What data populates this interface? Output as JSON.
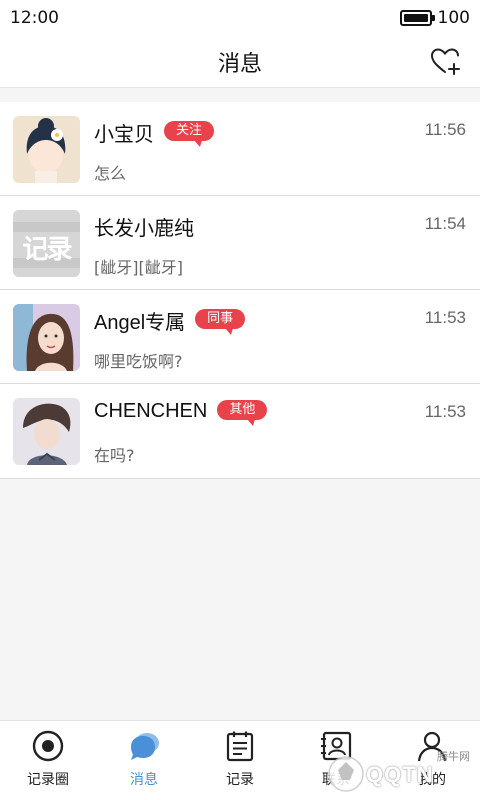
{
  "status_bar": {
    "time": "12:00",
    "battery": "100"
  },
  "header": {
    "title": "消息",
    "action_icon": "heart-plus-icon"
  },
  "messages": [
    {
      "name": "小宝贝",
      "tag": "关注",
      "time": "11:56",
      "preview": "怎么",
      "avatar": "girl-flower-avatar"
    },
    {
      "name": "长发小鹿纯",
      "tag": "",
      "time": "11:54",
      "preview": "[龇牙][龇牙]",
      "avatar": "app-logo-avatar",
      "avatar_text": "记录"
    },
    {
      "name": "Angel专属",
      "tag": "同事",
      "time": "11:53",
      "preview": "哪里吃饭啊?",
      "avatar": "woman-portrait-avatar"
    },
    {
      "name": "CHENCHEN",
      "tag": "其他",
      "time": "11:53",
      "preview": "在吗?",
      "avatar": "man-portrait-avatar"
    }
  ],
  "bottom_nav": [
    {
      "label": "记录圈",
      "icon": "eye-circle-icon",
      "active": false
    },
    {
      "label": "消息",
      "icon": "chat-bubble-icon",
      "active": true
    },
    {
      "label": "记录",
      "icon": "notepad-icon",
      "active": false
    },
    {
      "label": "联系",
      "icon": "contact-card-icon",
      "active": false
    },
    {
      "label": "我的",
      "icon": "user-icon",
      "active": false
    }
  ],
  "colors": {
    "tag": "#e8424b",
    "active_nav": "#4a90d9",
    "separator": "#dcdcdc"
  },
  "watermark": {
    "text": "QQTN",
    "subtext": "腾牛网"
  }
}
